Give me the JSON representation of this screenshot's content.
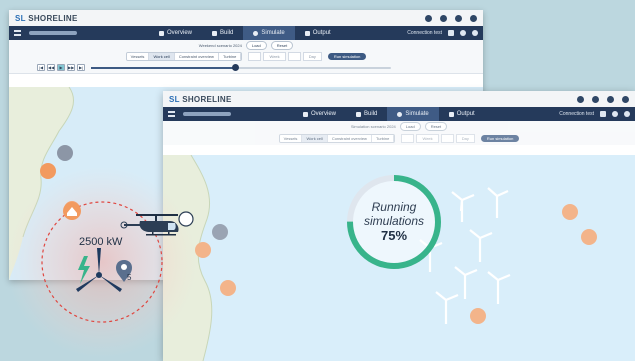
{
  "app": {
    "logo_prefix": "SL",
    "logo_name": "SHORELINE"
  },
  "back_window": {
    "tabs": [
      {
        "label": "Overview",
        "icon": "document-icon"
      },
      {
        "label": "Build",
        "icon": "grid-icon"
      },
      {
        "label": "Simulate",
        "icon": "clock-icon",
        "active": true
      },
      {
        "label": "Output",
        "icon": "chart-icon"
      }
    ],
    "nav_right_text": "Connection test",
    "sim_row": {
      "caption": "Weekend scenario 2024",
      "load": "Load",
      "reset": "Reset"
    },
    "views": [
      "Vessels",
      "Work cell",
      "Constraint overview",
      "Turbine"
    ],
    "pager": [
      "",
      "Week",
      "",
      "Day"
    ],
    "run_label": "Run simulation",
    "playback": [
      "|◀",
      "◀◀",
      "▶",
      "▶▶",
      "▶|"
    ],
    "playback_active_index": 2,
    "slider_progress": 0.48
  },
  "front_window": {
    "tabs": [
      {
        "label": "Overview",
        "icon": "document-icon"
      },
      {
        "label": "Build",
        "icon": "grid-icon"
      },
      {
        "label": "Simulate",
        "icon": "clock-icon",
        "active": true
      },
      {
        "label": "Output",
        "icon": "chart-icon"
      }
    ],
    "nav_right_text": "Connection test",
    "sim_row": {
      "caption": "Simulation scenario 2024",
      "load": "Load",
      "reset": "Reset"
    },
    "views": [
      "Vessels",
      "Work cell",
      "Constraint overview",
      "Turbine"
    ],
    "pager": [
      "",
      "Week",
      "",
      "Day"
    ],
    "run_label": "Run simulation"
  },
  "overlay": {
    "power_label": "2500 kW",
    "running_line1": "Running",
    "running_line2": "simulations",
    "progress_text": "75%",
    "progress_value": 0.75
  },
  "colors": {
    "nav": "#253a5b",
    "sea": "#d6ecf8",
    "land": "#e6ecd9",
    "marker": "#f29a5f",
    "accent_green": "#38b48b",
    "danger_red": "#e0463f"
  }
}
